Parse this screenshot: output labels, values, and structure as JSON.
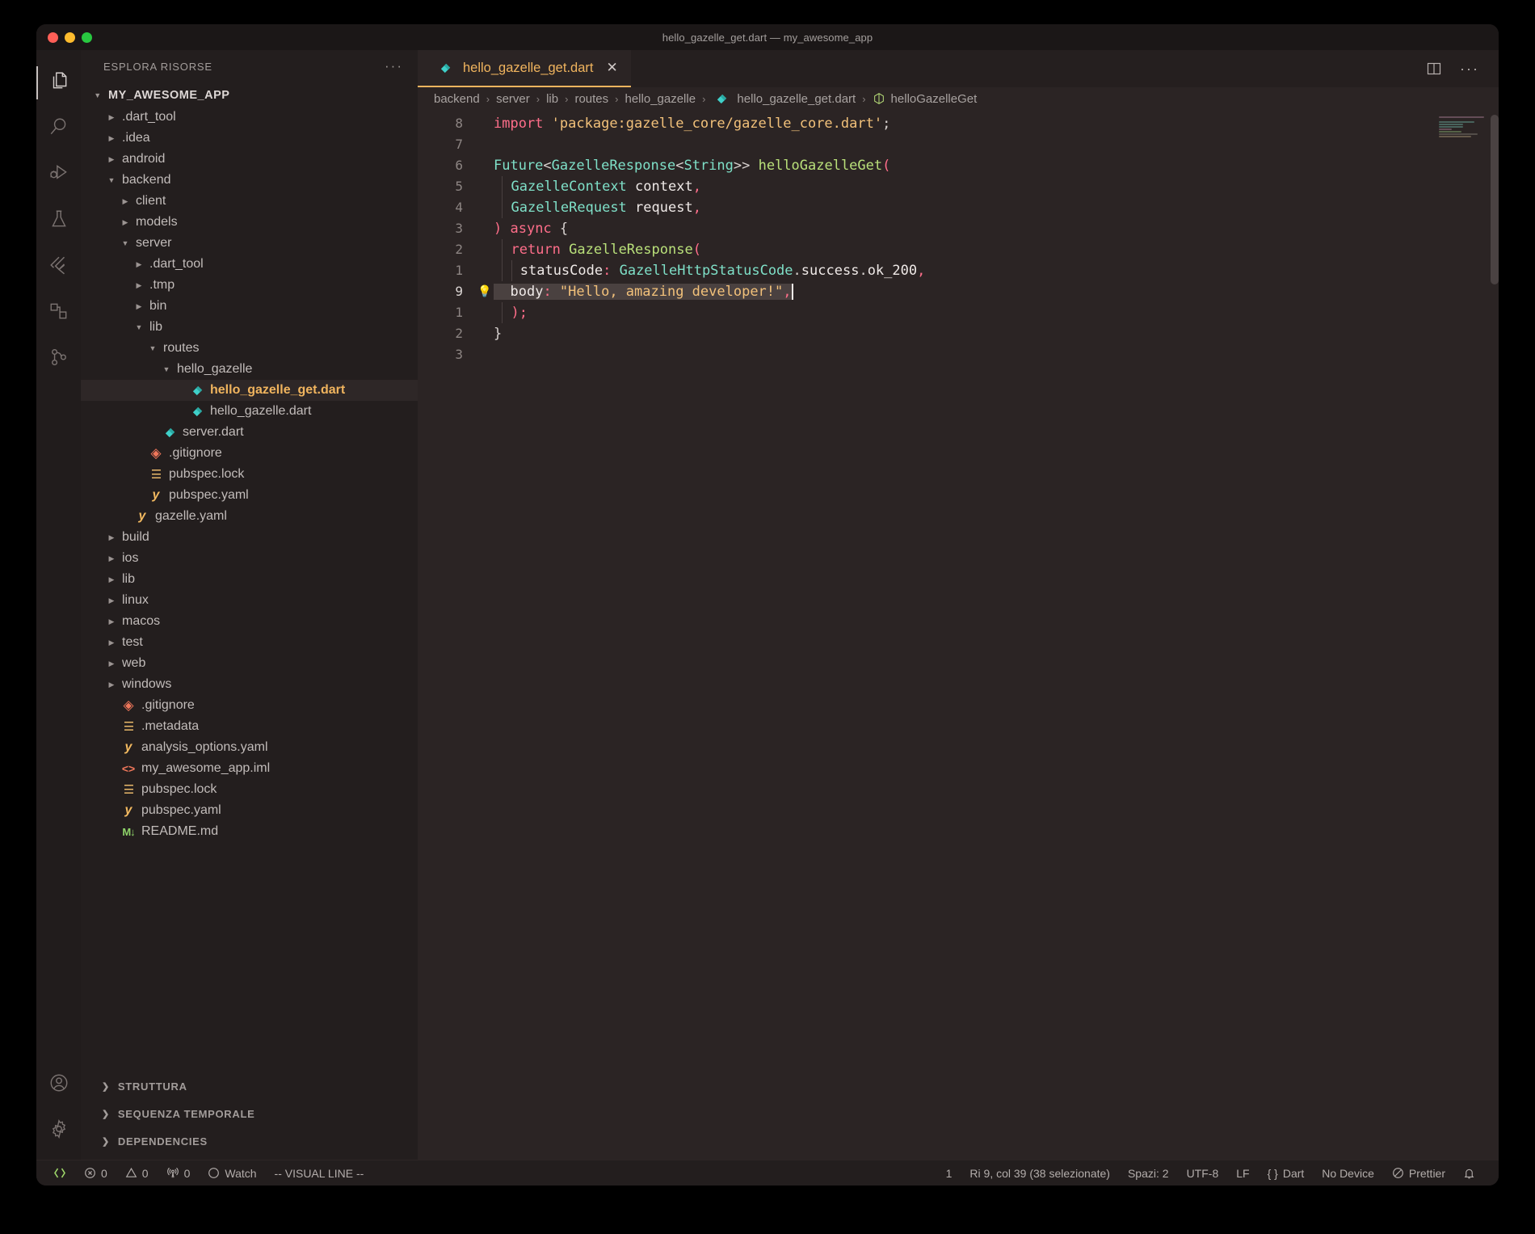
{
  "window": {
    "title": "hello_gazelle_get.dart — my_awesome_app",
    "lights": [
      "close",
      "minimize",
      "maximize"
    ]
  },
  "activitybar": {
    "items": [
      {
        "name": "explorer",
        "icon": "files-icon",
        "active": true
      },
      {
        "name": "search",
        "icon": "search-icon",
        "active": false
      },
      {
        "name": "run-and-debug",
        "icon": "run-debug-icon",
        "active": false
      },
      {
        "name": "testing",
        "icon": "flask-icon",
        "active": false
      },
      {
        "name": "flutter",
        "icon": "flutter-icon",
        "active": false
      },
      {
        "name": "extensions",
        "icon": "extensions-icon",
        "active": false
      },
      {
        "name": "source-control",
        "icon": "source-control-icon",
        "active": false
      }
    ],
    "bottom": [
      {
        "name": "accounts",
        "icon": "account-icon"
      },
      {
        "name": "manage",
        "icon": "gear-icon"
      }
    ]
  },
  "sidebar": {
    "header_title": "ESPLORA RISORSE",
    "header_more": "···",
    "tree": [
      {
        "label": "MY_AWESOME_APP",
        "depth": 0,
        "kind": "root",
        "state": "expanded"
      },
      {
        "label": ".dart_tool",
        "depth": 1,
        "kind": "folder",
        "state": "collapsed"
      },
      {
        "label": ".idea",
        "depth": 1,
        "kind": "folder",
        "state": "collapsed"
      },
      {
        "label": "android",
        "depth": 1,
        "kind": "folder",
        "state": "collapsed"
      },
      {
        "label": "backend",
        "depth": 1,
        "kind": "folder",
        "state": "expanded"
      },
      {
        "label": "client",
        "depth": 2,
        "kind": "folder",
        "state": "collapsed"
      },
      {
        "label": "models",
        "depth": 2,
        "kind": "folder",
        "state": "collapsed"
      },
      {
        "label": "server",
        "depth": 2,
        "kind": "folder",
        "state": "expanded"
      },
      {
        "label": ".dart_tool",
        "depth": 3,
        "kind": "folder",
        "state": "collapsed"
      },
      {
        "label": ".tmp",
        "depth": 3,
        "kind": "folder",
        "state": "collapsed"
      },
      {
        "label": "bin",
        "depth": 3,
        "kind": "folder",
        "state": "collapsed"
      },
      {
        "label": "lib",
        "depth": 3,
        "kind": "folder",
        "state": "expanded"
      },
      {
        "label": "routes",
        "depth": 4,
        "kind": "folder",
        "state": "expanded"
      },
      {
        "label": "hello_gazelle",
        "depth": 5,
        "kind": "folder",
        "state": "expanded"
      },
      {
        "label": "hello_gazelle_get.dart",
        "depth": 6,
        "kind": "dart",
        "state": "file",
        "selected": true
      },
      {
        "label": "hello_gazelle.dart",
        "depth": 6,
        "kind": "dart",
        "state": "file"
      },
      {
        "label": "server.dart",
        "depth": 4,
        "kind": "dart",
        "state": "file"
      },
      {
        "label": ".gitignore",
        "depth": 3,
        "kind": "git",
        "state": "file"
      },
      {
        "label": "pubspec.lock",
        "depth": 3,
        "kind": "lock",
        "state": "file"
      },
      {
        "label": "pubspec.yaml",
        "depth": 3,
        "kind": "yaml",
        "state": "file"
      },
      {
        "label": "gazelle.yaml",
        "depth": 2,
        "kind": "yaml",
        "state": "file"
      },
      {
        "label": "build",
        "depth": 1,
        "kind": "folder",
        "state": "collapsed"
      },
      {
        "label": "ios",
        "depth": 1,
        "kind": "folder",
        "state": "collapsed"
      },
      {
        "label": "lib",
        "depth": 1,
        "kind": "folder",
        "state": "collapsed"
      },
      {
        "label": "linux",
        "depth": 1,
        "kind": "folder",
        "state": "collapsed"
      },
      {
        "label": "macos",
        "depth": 1,
        "kind": "folder",
        "state": "collapsed"
      },
      {
        "label": "test",
        "depth": 1,
        "kind": "folder",
        "state": "collapsed"
      },
      {
        "label": "web",
        "depth": 1,
        "kind": "folder",
        "state": "collapsed"
      },
      {
        "label": "windows",
        "depth": 1,
        "kind": "folder",
        "state": "collapsed"
      },
      {
        "label": ".gitignore",
        "depth": 1,
        "kind": "git",
        "state": "file"
      },
      {
        "label": ".metadata",
        "depth": 1,
        "kind": "lock",
        "state": "file"
      },
      {
        "label": "analysis_options.yaml",
        "depth": 1,
        "kind": "yaml",
        "state": "file"
      },
      {
        "label": "my_awesome_app.iml",
        "depth": 1,
        "kind": "iml",
        "state": "file"
      },
      {
        "label": "pubspec.lock",
        "depth": 1,
        "kind": "lock",
        "state": "file"
      },
      {
        "label": "pubspec.yaml",
        "depth": 1,
        "kind": "yaml",
        "state": "file"
      },
      {
        "label": "README.md",
        "depth": 1,
        "kind": "md",
        "state": "file"
      }
    ],
    "panels": [
      {
        "label": "STRUTTURA",
        "state": "collapsed"
      },
      {
        "label": "SEQUENZA TEMPORALE",
        "state": "collapsed"
      },
      {
        "label": "DEPENDENCIES",
        "state": "collapsed"
      }
    ]
  },
  "editor": {
    "tab": {
      "label": "hello_gazelle_get.dart",
      "icon": "dart-icon",
      "close": "✕",
      "active": true
    },
    "actions": {
      "split": "split-editor-icon",
      "more": "···"
    },
    "breadcrumbs": [
      {
        "label": "backend",
        "icon": null
      },
      {
        "label": "server",
        "icon": null
      },
      {
        "label": "lib",
        "icon": null
      },
      {
        "label": "routes",
        "icon": null
      },
      {
        "label": "hello_gazelle",
        "icon": null
      },
      {
        "label": "hello_gazelle_get.dart",
        "icon": "dart-icon"
      },
      {
        "label": "helloGazelleGet",
        "icon": "symbol-cube-icon"
      }
    ],
    "breadcrumb_separator": "›",
    "lines": [
      {
        "num": "8",
        "bulb": false
      },
      {
        "num": "7",
        "bulb": false
      },
      {
        "num": "6",
        "bulb": false
      },
      {
        "num": "5",
        "bulb": false
      },
      {
        "num": "4",
        "bulb": false
      },
      {
        "num": "3",
        "bulb": false
      },
      {
        "num": "2",
        "bulb": false
      },
      {
        "num": "1",
        "bulb": false
      },
      {
        "num": "9",
        "bulb": true,
        "current": true
      },
      {
        "num": "1",
        "bulb": false
      },
      {
        "num": "2",
        "bulb": false
      },
      {
        "num": "3",
        "bulb": false
      }
    ],
    "code_text": {
      "l1_import": "import",
      "l1_string": "'package:gazelle_core/gazelle_core.dart'",
      "l1_semi": ";",
      "l3_future": "Future",
      "l3_lt": "<",
      "l3_gazresp": "GazelleResponse",
      "l3_lt2": "<",
      "l3_string": "String",
      "l3_gtgt": ">>",
      "l3_fn": " helloGazelleGet",
      "l3_paren": "(",
      "l4_type": "GazelleContext",
      "l4_name": " context",
      "l4_comma": ",",
      "l5_type": "GazelleRequest",
      "l5_name": " request",
      "l5_comma": ",",
      "l6_close": ")",
      "l6_async": " async",
      "l6_brace": " {",
      "l7_return": "return",
      "l7_fn": " GazelleResponse",
      "l7_paren": "(",
      "l8_key": "statusCode",
      "l8_colon": ": ",
      "l8_type": "GazelleHttpStatusCode",
      "l8_dot1": ".",
      "l8_prop1": "success",
      "l8_dot2": ".",
      "l8_prop2": "ok_200",
      "l8_comma": ",",
      "l9_key": "body",
      "l9_colon": ": ",
      "l9_string": "\"Hello, amazing developer!\"",
      "l9_comma": ",",
      "l10_close": ");",
      "l11_brace": "}"
    }
  },
  "statusbar": {
    "left": [
      {
        "name": "remote-window",
        "icon": "remote-icon",
        "label": ""
      },
      {
        "name": "problems-errors",
        "icon": "error-circle-icon",
        "label": "0"
      },
      {
        "name": "problems-warnings",
        "icon": "warning-triangle-icon",
        "label": "0"
      },
      {
        "name": "ports",
        "icon": "radio-tower-icon",
        "label": "0"
      },
      {
        "name": "watch",
        "icon": "circle-icon",
        "label": "Watch"
      },
      {
        "name": "vim-mode",
        "icon": null,
        "label": "-- VISUAL LINE --"
      }
    ],
    "right": [
      {
        "name": "editor-count",
        "icon": null,
        "label": "1"
      },
      {
        "name": "cursor-position",
        "icon": null,
        "label": "Ri 9, col 39 (38 selezionate)"
      },
      {
        "name": "indentation",
        "icon": null,
        "label": "Spazi: 2"
      },
      {
        "name": "encoding",
        "icon": null,
        "label": "UTF-8"
      },
      {
        "name": "eol",
        "icon": null,
        "label": "LF"
      },
      {
        "name": "language-mode",
        "icon": "braces-icon",
        "label": "Dart"
      },
      {
        "name": "device",
        "icon": null,
        "label": "No Device"
      },
      {
        "name": "formatter-prettier",
        "icon": "prohibited-icon",
        "label": "Prettier"
      },
      {
        "name": "notifications",
        "icon": "bell-icon",
        "label": ""
      }
    ]
  },
  "colors": {
    "accent": "#f0b45e",
    "keyword": "#ff6e8a",
    "string": "#f2c17a",
    "type": "#7fe0c8",
    "function": "#b9e07a",
    "editor_bg": "#2b2424",
    "sidebar_bg": "#231e1e"
  }
}
